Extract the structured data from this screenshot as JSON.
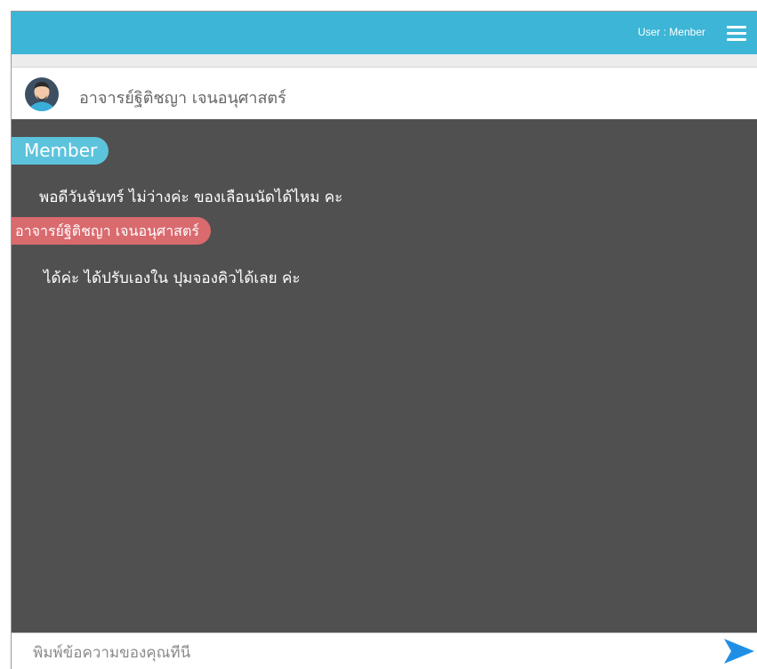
{
  "topbar": {
    "user_label": "User :  Menber",
    "menu_icon": "hamburger-menu-icon",
    "color": "#3db5d6"
  },
  "chat_header": {
    "avatar_icon": "user-avatar-icon",
    "contact_name": "อาจารย์ฐิติชญา เจนอนุศาสตร์"
  },
  "messages": [
    {
      "sender_label": "Member",
      "sender_color": "#5cc3dc",
      "text": "พอดีวันจันทร์ ไม่ว่างค่ะ ของเลือนนัดได้ไหม คะ"
    },
    {
      "sender_label": "อาจารย์ฐิติชญา เจนอนุศาสตร์",
      "sender_color": "#d96a6e",
      "text": "ได้ค่ะ ได้ปรับเองใน ปุมจองคิวได้เลย ค่ะ"
    }
  ],
  "composer": {
    "placeholder": "พิมพ์ข้อความของคุณทีนี",
    "value": "",
    "send_icon": "send-arrow-icon",
    "send_color": "#1f8fe6"
  },
  "colors": {
    "chat_background": "#505050"
  }
}
